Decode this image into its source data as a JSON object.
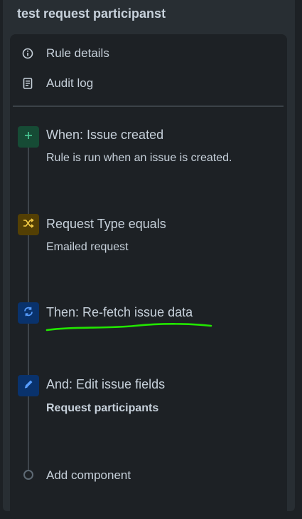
{
  "rule": {
    "title": "test request participanst"
  },
  "nav": {
    "rule_details": "Rule details",
    "audit_log": "Audit log"
  },
  "steps": [
    {
      "title": "When: Issue created",
      "desc": "Rule is run when an issue is created.",
      "icon": "plus-icon",
      "color": "#164b35"
    },
    {
      "title": "Request Type equals",
      "desc": "Emailed request",
      "icon": "shuffle-icon",
      "color": "#533f04"
    },
    {
      "title": "Then: Re-fetch issue data",
      "desc": "",
      "icon": "refresh-icon",
      "color": "#09326c"
    },
    {
      "title": "And: Edit issue fields",
      "desc": "Request participants",
      "icon": "pencil-icon",
      "color": "#09326c"
    }
  ],
  "add_component": "Add component",
  "colors": {
    "annotation": "#22e600",
    "accent_blue": "#579dff",
    "accent_green": "#4bce97",
    "accent_yellow": "#f5cd47"
  }
}
